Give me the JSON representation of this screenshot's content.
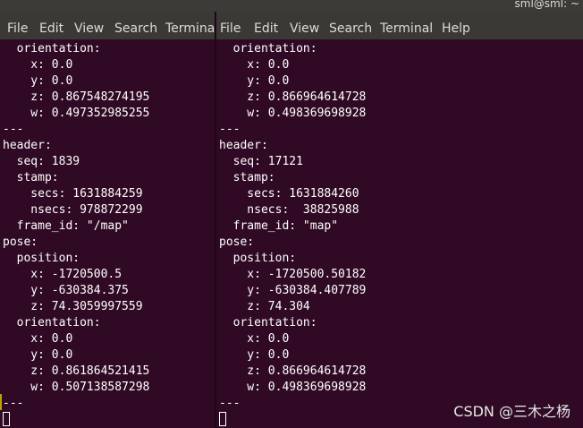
{
  "window": {
    "title": "sml@sml: ~"
  },
  "left_pane": {
    "menu": [
      "File",
      "Edit",
      "View",
      "Search",
      "Terminal"
    ],
    "lines": [
      "  orientation:",
      "    x: 0.0",
      "    y: 0.0",
      "    z: 0.867548274195",
      "    w: 0.497352985255",
      "---",
      "header:",
      "  seq: 1839",
      "  stamp:",
      "    secs: 1631884259",
      "    nsecs: 978872299",
      "  frame_id: \"/map\"",
      "pose:",
      "  position:",
      "    x: -1720500.5",
      "    y: -630384.375",
      "    z: 74.3059997559",
      "  orientation:",
      "    x: 0.0",
      "    y: 0.0",
      "    z: 0.861864521415",
      "    w: 0.507138587298",
      "---"
    ]
  },
  "right_pane": {
    "menu": [
      "File",
      "Edit",
      "View",
      "Search",
      "Terminal",
      "Help"
    ],
    "lines": [
      "  orientation:",
      "    x: 0.0",
      "    y: 0.0",
      "    z: 0.866964614728",
      "    w: 0.498369698928",
      "---",
      "header:",
      "  seq: 17121",
      "  stamp:",
      "    secs: 1631884260",
      "    nsecs:  38825988",
      "  frame_id: \"map\"",
      "pose:",
      "  position:",
      "    x: -1720500.50182",
      "    y: -630384.407789",
      "    z: 74.304",
      "  orientation:",
      "    x: 0.0",
      "    y: 0.0",
      "    z: 0.866964614728",
      "    w: 0.498369698928",
      "---"
    ]
  },
  "watermark": "CSDN @三木之杨",
  "colors": {
    "terminal_bg": "#300a24",
    "menubar_bg": "#3a3935",
    "text": "#ffffff",
    "menu_text": "#dfdbd2"
  }
}
